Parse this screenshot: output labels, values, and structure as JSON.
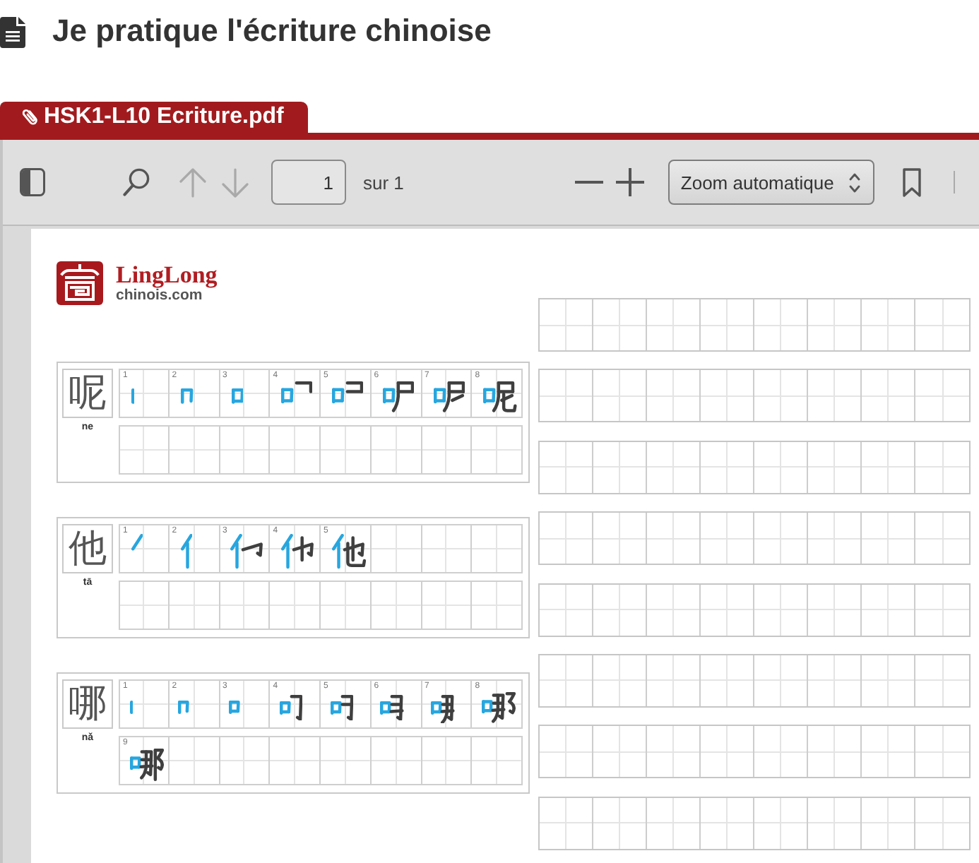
{
  "header": {
    "title": "Je pratique l'écriture chinoise"
  },
  "attachment_tab": {
    "label": "HSK1-L10 Ecriture.pdf"
  },
  "toolbar": {
    "previous_page": {
      "disabled": true
    },
    "next_page": {
      "disabled": true
    },
    "page_input": {
      "value": "1"
    },
    "page_total": "sur 1",
    "zoom_select": {
      "value": "Zoom automatique"
    }
  },
  "worksheet": {
    "logo": {
      "name": "LingLong",
      "domain": "chinois.com"
    },
    "characters": [
      {
        "character": "呢",
        "pinyin": "ne",
        "steps": [
          "1",
          "2",
          "3",
          "4",
          "5",
          "6",
          "7",
          "8"
        ]
      },
      {
        "character": "他",
        "pinyin": "tā",
        "steps": [
          "1",
          "2",
          "3",
          "4",
          "5"
        ]
      },
      {
        "character": "哪",
        "pinyin": "nǎ",
        "steps": [
          "1",
          "2",
          "3",
          "4",
          "5",
          "6",
          "7",
          "8",
          "9"
        ]
      }
    ]
  }
}
